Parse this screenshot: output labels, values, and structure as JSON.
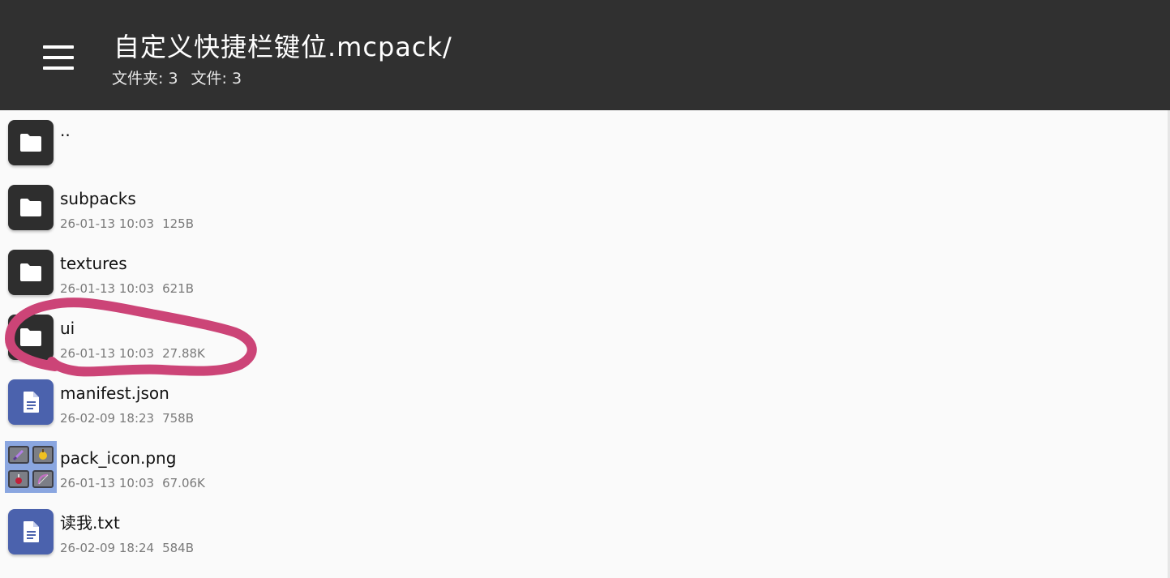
{
  "header": {
    "title": "自定义快捷栏键位.mcpack/",
    "folders_label": "文件夹: 3",
    "files_label": "文件: 3"
  },
  "files": [
    {
      "name": "..",
      "type": "folder",
      "date": "",
      "size": ""
    },
    {
      "name": "subpacks",
      "type": "folder",
      "date": "26-01-13 10:03",
      "size": "125B"
    },
    {
      "name": "textures",
      "type": "folder",
      "date": "26-01-13 10:03",
      "size": "621B"
    },
    {
      "name": "ui",
      "type": "folder",
      "date": "26-01-13 10:03",
      "size": "27.88K"
    },
    {
      "name": "manifest.json",
      "type": "file",
      "date": "26-02-09 18:23",
      "size": "758B"
    },
    {
      "name": "pack_icon.png",
      "type": "image",
      "date": "26-01-13 10:03",
      "size": "67.06K"
    },
    {
      "name": "读我.txt",
      "type": "file",
      "date": "26-02-09 18:24",
      "size": "584B"
    }
  ],
  "icons": {
    "menu": "menu-icon",
    "folder": "folder-icon",
    "file": "document-icon",
    "image": "image-thumbnail"
  },
  "colors": {
    "header_bg": "#303030",
    "folder_tile": "#2e2e2e",
    "file_tile": "#4b62ad",
    "annotation": "#cc4477"
  }
}
